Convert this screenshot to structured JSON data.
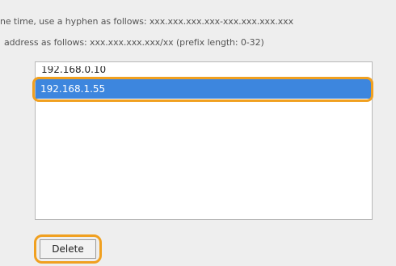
{
  "instructions": {
    "line1": "ne time, use a hyphen as follows: xxx.xxx.xxx.xxx-xxx.xxx.xxx.xxx",
    "line2": "address as follows: xxx.xxx.xxx.xxx/xx (prefix length: 0-32)"
  },
  "address_list": {
    "items": [
      "192.168.0.10",
      "192.168.1.55"
    ],
    "selected_index": 1
  },
  "actions": {
    "delete_label": "Delete"
  },
  "colors": {
    "selection": "#3d86de",
    "highlight": "#f0a020",
    "background": "#eeeeee"
  }
}
